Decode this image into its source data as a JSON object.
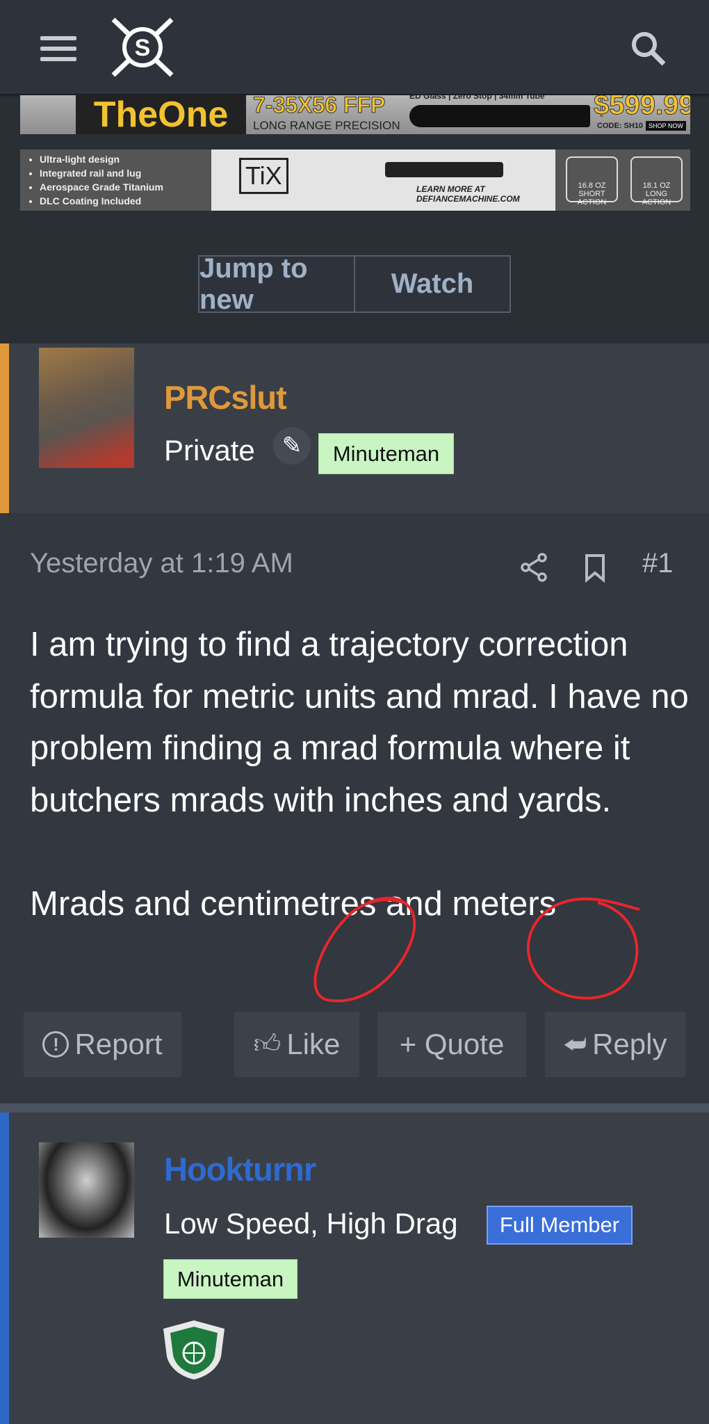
{
  "header": {
    "menu_icon": "hamburger-icon",
    "logo": "crosshair-logo",
    "search_icon": "search-icon"
  },
  "ads": [
    {
      "brand": "TheOne",
      "model": "7-35X56 FFP",
      "tagline": "LONG RANGE PRECISION",
      "features": "ED Glass | Zero Stop | 34mm Tube",
      "price": "$599.99",
      "code": "CODE: SH10",
      "cta": "SHOP NOW"
    },
    {
      "bullets": [
        "Ultra-light design",
        "Integrated rail and lug",
        "Aerospace Grade Titanium",
        "DLC Coating Included"
      ],
      "logo": "TiX",
      "cta": "LEARN MORE AT DEFIANCEMACHINE.COM",
      "short": "16.8 OZ SHORT ACTION",
      "long": "18.1 OZ LONG ACTION"
    }
  ],
  "thread_actions": {
    "jump": "Jump to new",
    "watch": "Watch"
  },
  "posts": [
    {
      "username": "PRCslut",
      "user_title": "Private",
      "badge": "Minuteman",
      "name_color": "#e0993a",
      "accent": "#e0993a",
      "timestamp": "Yesterday at 1:19 AM",
      "number": "#1",
      "body": [
        "I am trying to find a trajectory correction formula for metric units and mrad. I have no problem finding a mrad formula where it butchers mrads with inches and yards.",
        "Mrads and centimetres and meters"
      ],
      "actions": {
        "report": "Report",
        "like": "Like",
        "quote": "+ Quote",
        "reply": "Reply"
      }
    },
    {
      "username": "Hookturnr",
      "user_title": "Low Speed, High Drag",
      "badge1": "Full Member",
      "badge2": "Minuteman",
      "name_color": "#2e6bd0",
      "accent": "#2d68c4"
    }
  ]
}
